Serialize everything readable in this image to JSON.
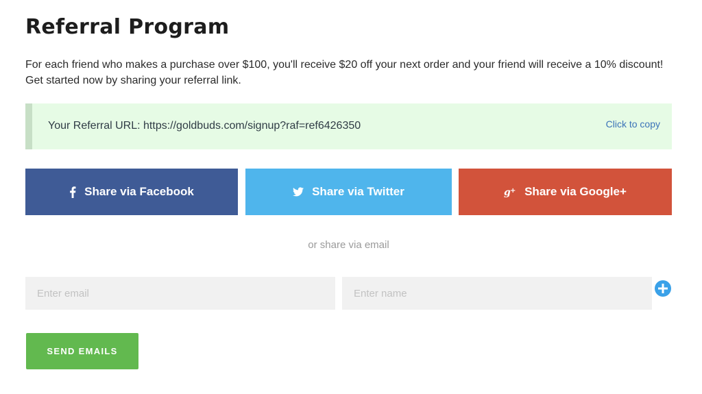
{
  "page": {
    "title": "Referral Program",
    "intro": "For each friend who makes a purchase over $100, you'll receive $20 off your next order and your friend will receive a 10% discount! Get started now by sharing your referral link."
  },
  "referral": {
    "label": "Your Referral URL:",
    "url": "https://goldbuds.com/signup?raf=ref6426350",
    "copy_label": "Click to copy"
  },
  "share": {
    "facebook": {
      "label": "Share via Facebook",
      "icon": "facebook-icon",
      "color": "#3f5b96"
    },
    "twitter": {
      "label": "Share via Twitter",
      "icon": "twitter-icon",
      "color": "#4fb5ec"
    },
    "google": {
      "label": "Share via Google+",
      "icon": "google-plus-icon",
      "color": "#d2533b"
    }
  },
  "email_section": {
    "divider_text": "or share via email",
    "email_placeholder": "Enter email",
    "name_placeholder": "Enter name",
    "add_icon": "plus-circle-icon",
    "send_label": "SEND EMAILS"
  },
  "colors": {
    "url_box_bg": "#e6fbe5",
    "send_button": "#62b94f",
    "add_button": "#3aa1e8",
    "link": "#3a72b8"
  }
}
